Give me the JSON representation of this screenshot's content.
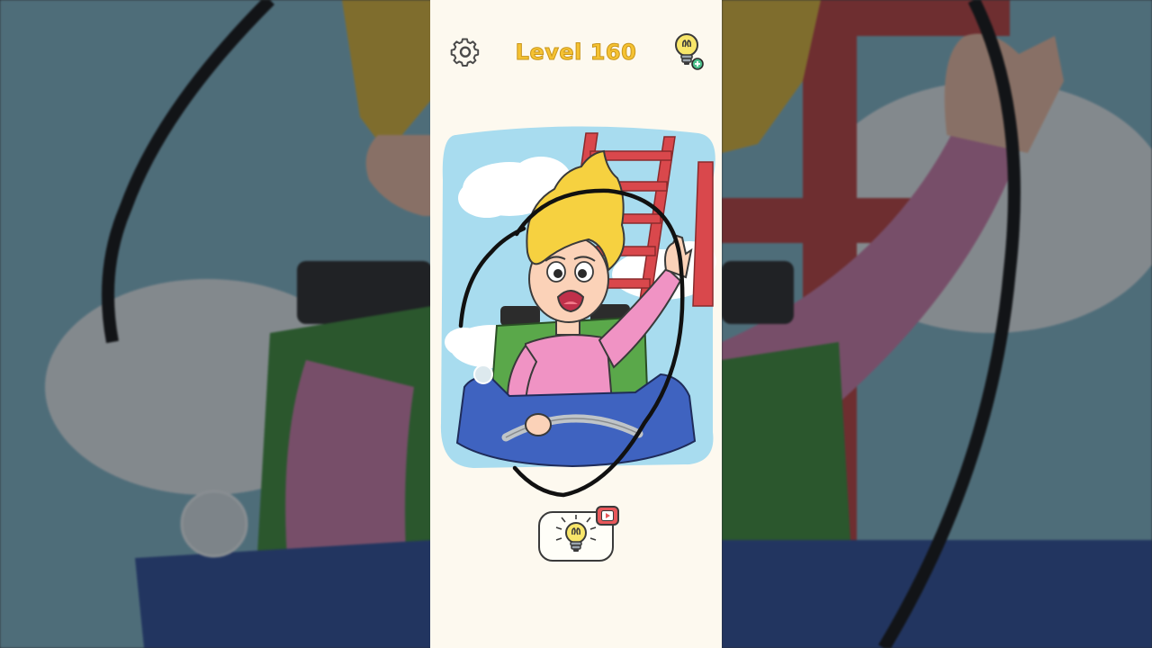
{
  "header": {
    "level_label": "Level 160"
  },
  "icons": {
    "settings": "gear-icon",
    "hint_top": "lightbulb-plus-icon",
    "hint_video": "lightbulb-icon",
    "video_badge": "play-icon"
  },
  "colors": {
    "panel_background": "#fdf9ef",
    "level_text": "#f5c232",
    "sky": "#a8dcef",
    "hair": "#f6d140",
    "shirt": "#f093c4",
    "seat": "#5aa84a",
    "cart": "#3f63c0",
    "track": "#d9484c",
    "badge": "#e8575a"
  }
}
